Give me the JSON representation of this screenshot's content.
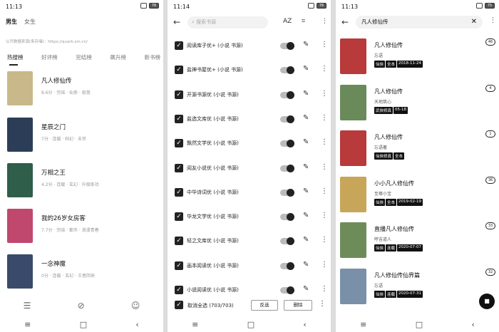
{
  "p1": {
    "time": "11:13",
    "battery": "76",
    "gender_tabs": [
      "男生",
      "女生"
    ],
    "source_text": "公开数据来源(来存储)：https://quark.sm.cn/",
    "rank_tabs": [
      "热搜榜",
      "好评榜",
      "完结榜",
      "飙升榜",
      "新书榜"
    ],
    "books": [
      {
        "title": "凡人修仙传",
        "meta": "8.6分 · 完结 · 仙侠 · 俊翁",
        "color": "#c9b98a"
      },
      {
        "title": "星辰之门",
        "meta": "7分 · 连载 · 科幻 · 末世",
        "color": "#2c3e57"
      },
      {
        "title": "万相之王",
        "meta": "4.2分 · 连载 · 玄幻 · 升级练功",
        "color": "#2f5e4a"
      },
      {
        "title": "我的26岁女房客",
        "meta": "7.7分 · 完结 · 都市 · 浪漫青春",
        "color": "#c0486e"
      },
      {
        "title": "一念神魔",
        "meta": "0分 · 连载 · 玄幻 · 王者回来",
        "color": "#3a4a6a"
      }
    ]
  },
  "p2": {
    "time": "11:14",
    "battery": "76",
    "search_placeholder": "搜索书源",
    "sort_icon_label": "AZ",
    "sources": [
      "阅读库子优+ (小说 书源)",
      "盐神书屋优+ (小说 书源)",
      "开源书源优 (小说 书源)",
      "盐选文库优 (小说 书源)",
      "飘然文学优 (小说 书源)",
      "阅友小说优 (小说 书源)",
      "中华诗词优 (小说 书源)",
      "华龙文学优 (小说 书源)",
      "轻之文库优 (小说 书源)",
      "画本阅读优 (小说 书源)",
      "小说阅读优 (小说 书源)"
    ],
    "select_all_label": "取消全选 (703/703)",
    "invert_label": "反选",
    "delete_label": "删除"
  },
  "p3": {
    "time": "11:13",
    "battery": "75",
    "query": "凡人修仙传",
    "results": [
      {
        "title": "凡人修仙传",
        "author": "忘语",
        "tags": [
          "仙侠",
          "全本",
          "2018-11-24"
        ],
        "count": "46",
        "color": "#b83a3a"
      },
      {
        "title": "凡人修仙传",
        "author": "天地筑心",
        "tags": [
          "武侠修真",
          "05-18"
        ],
        "count": "4",
        "color": "#6a8a5a"
      },
      {
        "title": "凡人修仙传",
        "author": "忘语著",
        "tags": [
          "仙侠修真",
          "全本"
        ],
        "count": "1",
        "color": "#b83a3a"
      },
      {
        "title": "小小凡人修仙传",
        "author": "至尊小宝",
        "tags": [
          "仙侠",
          "全本",
          "2019-02-19"
        ],
        "count": "36",
        "color": "#c7a65a"
      },
      {
        "title": "直播凡人修仙传",
        "author": "呼吉道人",
        "tags": [
          "仙侠",
          "连载",
          "2020-07-07"
        ],
        "count": "33",
        "color": "#6d8c5a"
      },
      {
        "title": "凡人修仙传仙界篇",
        "author": "忘语",
        "tags": [
          "仙侠",
          "连载",
          "2020-07-31"
        ],
        "count": "32",
        "color": "#7a8fa8"
      }
    ]
  }
}
